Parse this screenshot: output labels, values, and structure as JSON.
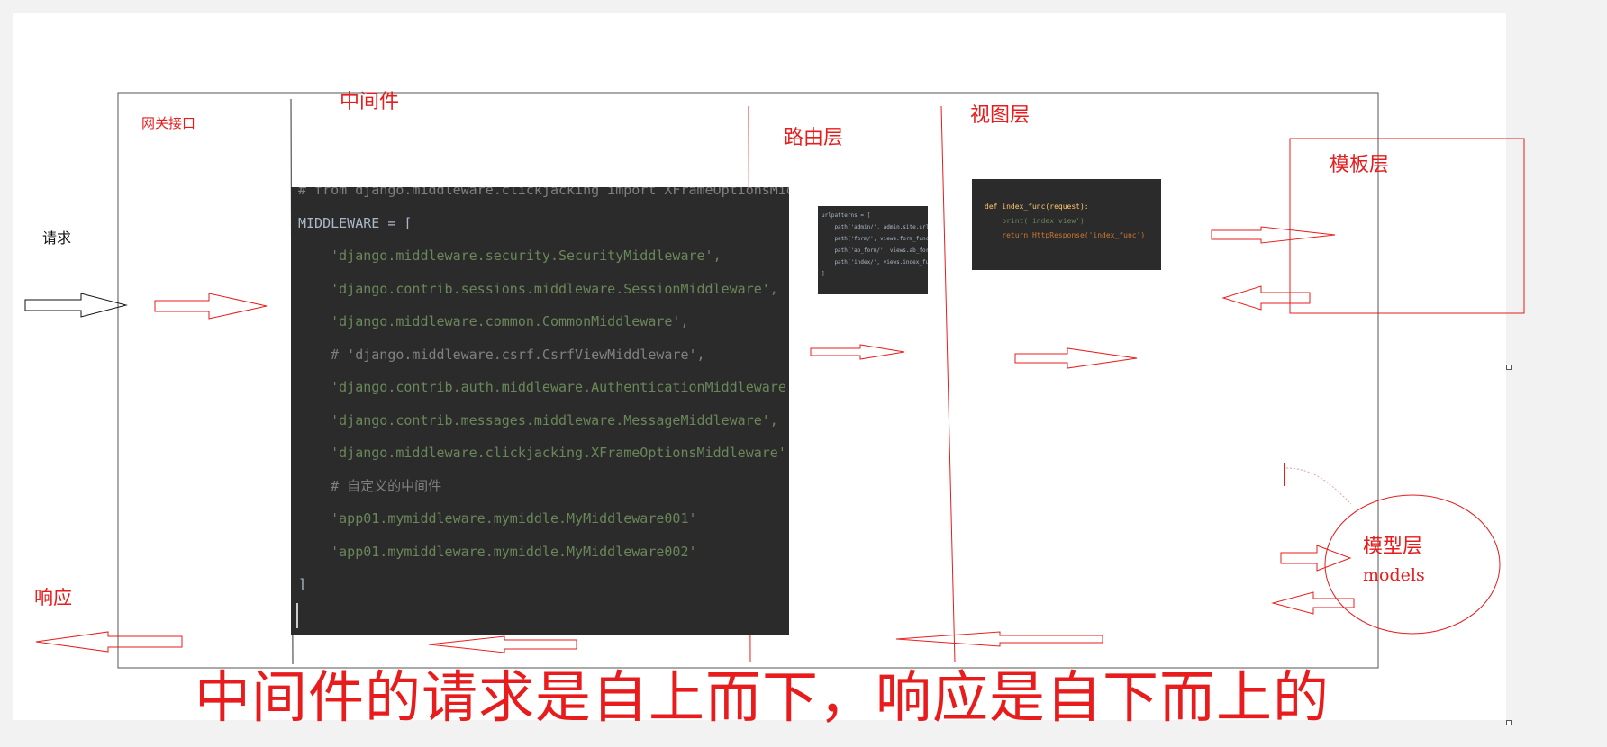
{
  "labels": {
    "gateway": "网关接口",
    "middleware": "中间件",
    "routing": "路由层",
    "view": "视图层",
    "template": "模板层",
    "request": "请求",
    "response": "响应",
    "model": "模型层",
    "models": "models",
    "caption": "中间件的请求是自上而下，响应是自下而上的"
  },
  "middleware_code": [
    {
      "text": "# from django.middleware.clickjacking import XFrameOptionsMiddlewa",
      "kind": "comment"
    },
    {
      "text": "MIDDLEWARE = [",
      "kind": "ident"
    },
    {
      "text": "    'django.middleware.security.SecurityMiddleware',",
      "kind": "string"
    },
    {
      "text": "    'django.contrib.sessions.middleware.SessionMiddleware',",
      "kind": "string"
    },
    {
      "text": "    'django.middleware.common.CommonMiddleware',",
      "kind": "string"
    },
    {
      "text": "    # 'django.middleware.csrf.CsrfViewMiddleware',",
      "kind": "comment"
    },
    {
      "text": "    'django.contrib.auth.middleware.AuthenticationMiddleware',",
      "kind": "string"
    },
    {
      "text": "    'django.contrib.messages.middleware.MessageMiddleware',",
      "kind": "string"
    },
    {
      "text": "    'django.middleware.clickjacking.XFrameOptionsMiddleware',",
      "kind": "string"
    },
    {
      "text": "    # 自定义的中间件",
      "kind": "comment"
    },
    {
      "text": "    'app01.mymiddleware.mymiddle.MyMiddleware001'",
      "kind": "string"
    },
    {
      "text": "    'app01.mymiddleware.mymiddle.MyMiddleware002'",
      "kind": "string"
    },
    {
      "text": "]",
      "kind": "ident"
    }
  ],
  "url_code": [
    "urlpatterns = [",
    "    path('admin/', admin.site.urls),",
    "    path('form/', views.form_func),",
    "    path('ab_form/', views.ab_form_func),",
    "    path('index/', views.index_func)",
    "]"
  ],
  "view_code": [
    "def index_func(request):",
    "    print('index view')",
    "    return HttpResponse('index_func')"
  ],
  "colors": {
    "annotation": "#e81c1c",
    "code_background": "#2b2b2b",
    "code_string": "#6a8759",
    "code_comment": "#808080"
  }
}
